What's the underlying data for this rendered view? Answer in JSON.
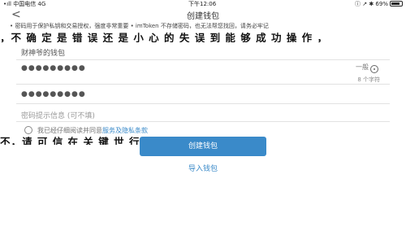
{
  "status_bar": {
    "carrier": "•ıll 中国电信 4G",
    "time": "下午12:06",
    "indicators": "ⓘ ↗ ✱ 69%"
  },
  "nav": {
    "back_icon": "back-arrow-icon",
    "title": "创建钱包"
  },
  "notice": {
    "text": "• 密码用于保护私钥和交易授权，强度非常重要 • imToken 不存储密码，也无法帮您找回，请务必牢记",
    "overlay_text": "，不 确 定 是 错 误 还 是 小 心 的 失 误 到 能 够 成 功 操 作 ，"
  },
  "form": {
    "wallet_name_label": "财神爷的钱包",
    "password_value": "●●●●●●●●●",
    "strength_label": "一般",
    "password_rule": "8 个字符",
    "confirm_value": "●●●●●●●●●",
    "hint_placeholder": "密码提示信息 (可不填)"
  },
  "agree": {
    "text_prefix": "我已经仔细阅读并同意",
    "link_text": "服务及隐私条款",
    "overlay_text": "不，请 可 信 在 关 键 世 行 的 时 刻 出 名 ，"
  },
  "buttons": {
    "create": "创建钱包",
    "import": "导入钱包"
  },
  "colors": {
    "accent": "#3a8ac9"
  }
}
